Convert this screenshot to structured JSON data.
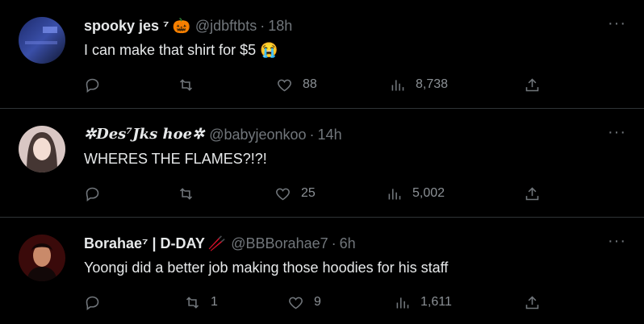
{
  "tweets": [
    {
      "name": "spooky jes ⁷",
      "emoji": "🎃",
      "handle": "@jdbftbts",
      "time": "18h",
      "text": "I can make that shirt for $5 😭",
      "replies": "",
      "retweets": "",
      "likes": "88",
      "views": "8,738"
    },
    {
      "name": "✲Des⁷Jks hoe✲",
      "emoji": "",
      "handle": "@babyjeonkoo",
      "time": "14h",
      "text": "WHERES THE FLAMES?!?!",
      "replies": "",
      "retweets": "",
      "likes": "25",
      "views": "5,002"
    },
    {
      "name": "Borahae⁷ | D-DAY",
      "emoji": "🥢",
      "handle": "@BBBorahae7",
      "time": "6h",
      "text": "Yoongi did a better job making those hoodies for his staff",
      "replies": "",
      "retweets": "1",
      "likes": "9",
      "views": "1,611"
    }
  ],
  "separator": "·",
  "more_glyph": "···",
  "icons": [
    "reply-icon",
    "retweet-icon",
    "like-icon",
    "views-icon",
    "share-icon",
    "more-icon"
  ],
  "colors": {
    "background": "#000000",
    "text": "#e7e9ea",
    "secondary": "#71767b",
    "divider": "#2f3336"
  }
}
